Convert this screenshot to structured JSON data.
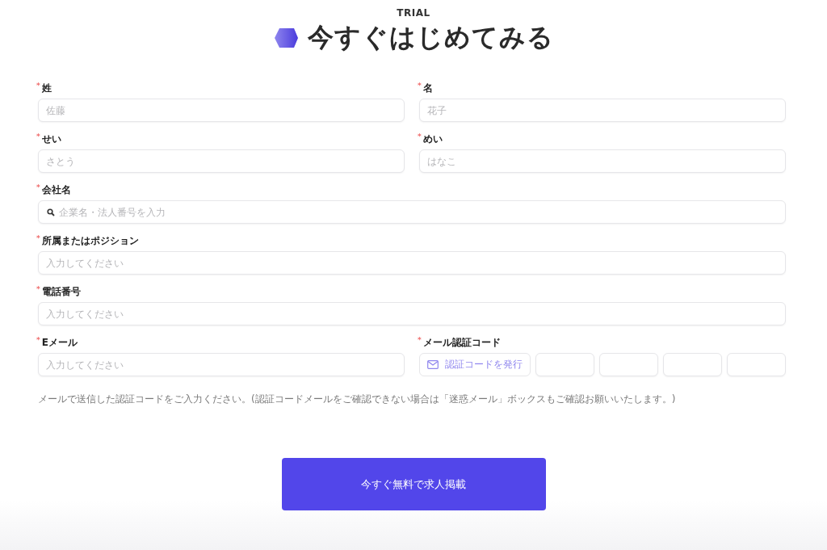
{
  "eyebrow": "TRIAL",
  "title": "今すぐはじめてみる",
  "rows": [
    [
      {
        "kind": "text",
        "label": "姓",
        "required": true,
        "placeholder": "佐藤"
      },
      {
        "kind": "text",
        "label": "名",
        "required": true,
        "placeholder": "花子"
      }
    ],
    [
      {
        "kind": "text",
        "label": "せい",
        "required": true,
        "placeholder": "さとう"
      },
      {
        "kind": "text",
        "label": "めい",
        "required": true,
        "placeholder": "はなこ"
      }
    ],
    [
      {
        "kind": "search",
        "label": "会社名",
        "required": true,
        "placeholder": "企業名・法人番号を入力"
      }
    ],
    [
      {
        "kind": "text",
        "label": "所属またはポジション",
        "required": true,
        "placeholder": "入力してください"
      }
    ],
    [
      {
        "kind": "text",
        "label": "電話番号",
        "required": true,
        "placeholder": "入力してください"
      }
    ],
    [
      {
        "kind": "text",
        "label": "Eメール",
        "required": true,
        "placeholder": "入力してください"
      },
      {
        "kind": "code",
        "label": "メール認証コード",
        "required": true,
        "button": "認証コードを発行"
      }
    ]
  ],
  "required_mark": "*",
  "note": "メールで送信した認証コードをご入力ください。(認証コードメールをご確認できない場合は「迷惑メール」ボックスもご確認お願いいたします。)",
  "submit": "今すぐ無料で求人掲載"
}
